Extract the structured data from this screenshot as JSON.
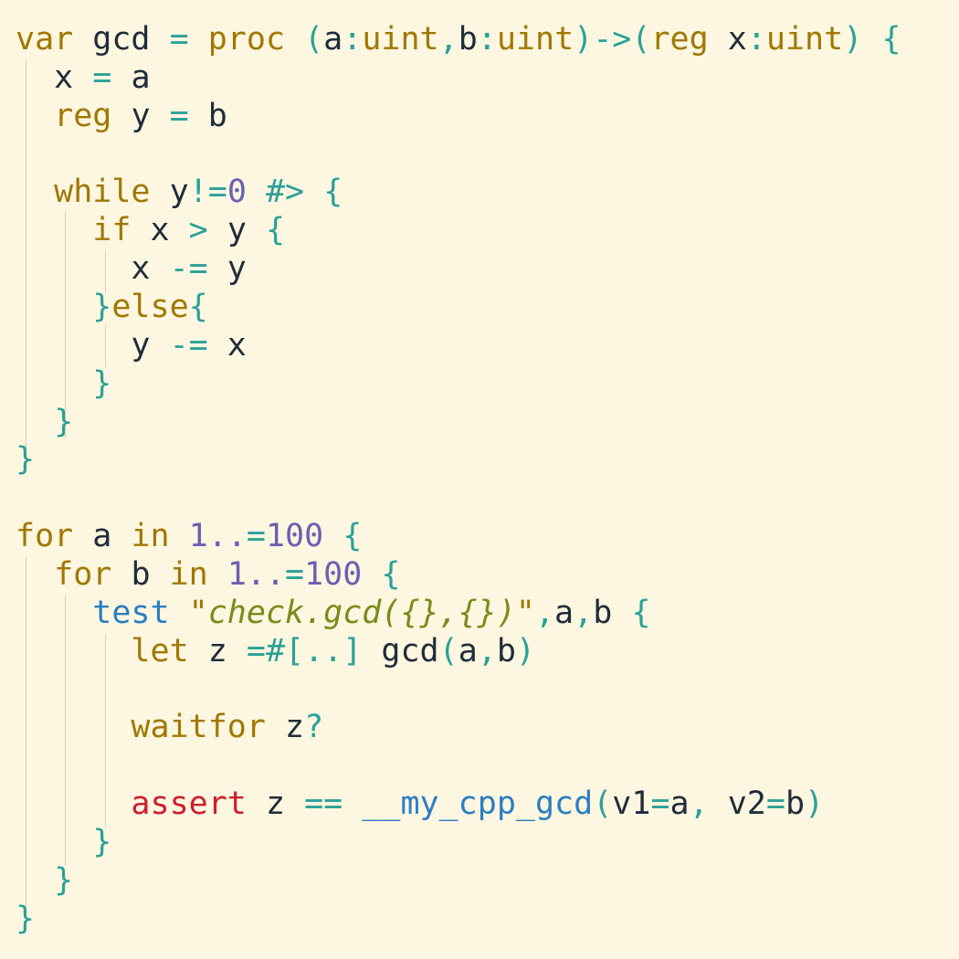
{
  "editor": {
    "language": "pyrope",
    "colors": {
      "background": "#fdf6e0",
      "keyword": "#a07800",
      "identifier": "#1f2d3a",
      "operator": "#2aa198",
      "number": "#6c5fb4",
      "string": "#7a8c1a",
      "test_keyword": "#2b7ec2",
      "assert_keyword": "#cc1f2e",
      "function_call": "#2b7ec2",
      "indent_guide": "#d6cfbb"
    },
    "lines": [
      [
        [
          "kw",
          "var"
        ],
        [
          "id",
          " gcd "
        ],
        [
          "op",
          "= "
        ],
        [
          "kw",
          "proc "
        ],
        [
          "op",
          "("
        ],
        [
          "id",
          "a"
        ],
        [
          "op",
          ":"
        ],
        [
          "kw",
          "uint"
        ],
        [
          "op",
          ","
        ],
        [
          "id",
          "b"
        ],
        [
          "op",
          ":"
        ],
        [
          "kw",
          "uint"
        ],
        [
          "op",
          ")->("
        ],
        [
          "kw",
          "reg "
        ],
        [
          "id",
          "x"
        ],
        [
          "op",
          ":"
        ],
        [
          "kw",
          "uint"
        ],
        [
          "op",
          ") {"
        ]
      ],
      [
        [
          "id",
          "  x "
        ],
        [
          "op",
          "= "
        ],
        [
          "id",
          "a"
        ]
      ],
      [
        [
          "kw",
          "  reg "
        ],
        [
          "id",
          "y "
        ],
        [
          "op",
          "= "
        ],
        [
          "id",
          "b"
        ]
      ],
      [],
      [
        [
          "kw",
          "  while "
        ],
        [
          "id",
          "y"
        ],
        [
          "op",
          "!="
        ],
        [
          "num",
          "0 "
        ],
        [
          "op",
          "#> {"
        ]
      ],
      [
        [
          "kw",
          "    if "
        ],
        [
          "id",
          "x "
        ],
        [
          "op",
          "> "
        ],
        [
          "id",
          "y "
        ],
        [
          "op",
          "{"
        ]
      ],
      [
        [
          "id",
          "      x "
        ],
        [
          "op",
          "-= "
        ],
        [
          "id",
          "y"
        ]
      ],
      [
        [
          "op",
          "    }"
        ],
        [
          "kw",
          "else"
        ],
        [
          "op",
          "{"
        ]
      ],
      [
        [
          "id",
          "      y "
        ],
        [
          "op",
          "-= "
        ],
        [
          "id",
          "x"
        ]
      ],
      [
        [
          "op",
          "    }"
        ]
      ],
      [
        [
          "op",
          "  }"
        ]
      ],
      [
        [
          "op",
          "}"
        ]
      ],
      [],
      [
        [
          "kw",
          "for "
        ],
        [
          "id",
          "a "
        ],
        [
          "kw",
          "in "
        ],
        [
          "num",
          "1.."
        ],
        [
          "op",
          "="
        ],
        [
          "num",
          "100 "
        ],
        [
          "op",
          "{"
        ]
      ],
      [
        [
          "kw",
          "  for "
        ],
        [
          "id",
          "b "
        ],
        [
          "kw",
          "in "
        ],
        [
          "num",
          "1.."
        ],
        [
          "op",
          "="
        ],
        [
          "num",
          "100 "
        ],
        [
          "op",
          "{"
        ]
      ],
      [
        [
          "tst",
          "    test "
        ],
        [
          "kw",
          "\""
        ],
        [
          "str",
          "check.gcd({},{})"
        ],
        [
          "kw",
          "\""
        ],
        [
          "op",
          ","
        ],
        [
          "id",
          "a"
        ],
        [
          "op",
          ","
        ],
        [
          "id",
          "b "
        ],
        [
          "op",
          "{"
        ]
      ],
      [
        [
          "kw",
          "      let "
        ],
        [
          "id",
          "z "
        ],
        [
          "op",
          "=#[..] "
        ],
        [
          "id",
          "gcd"
        ],
        [
          "op",
          "("
        ],
        [
          "id",
          "a"
        ],
        [
          "op",
          ","
        ],
        [
          "id",
          "b"
        ],
        [
          "op",
          ")"
        ]
      ],
      [],
      [
        [
          "kw",
          "      waitfor "
        ],
        [
          "id",
          "z"
        ],
        [
          "op",
          "?"
        ]
      ],
      [],
      [
        [
          "err",
          "      assert "
        ],
        [
          "id",
          "z "
        ],
        [
          "op",
          "== "
        ],
        [
          "fn",
          "__my_cpp_gcd"
        ],
        [
          "op",
          "("
        ],
        [
          "id",
          "v1"
        ],
        [
          "op",
          "="
        ],
        [
          "id",
          "a"
        ],
        [
          "op",
          ", "
        ],
        [
          "id",
          "v2"
        ],
        [
          "op",
          "="
        ],
        [
          "id",
          "b"
        ],
        [
          "op",
          ")"
        ]
      ],
      [
        [
          "op",
          "    }"
        ]
      ],
      [
        [
          "op",
          "  }"
        ]
      ],
      [
        [
          "op",
          "}"
        ]
      ]
    ]
  }
}
